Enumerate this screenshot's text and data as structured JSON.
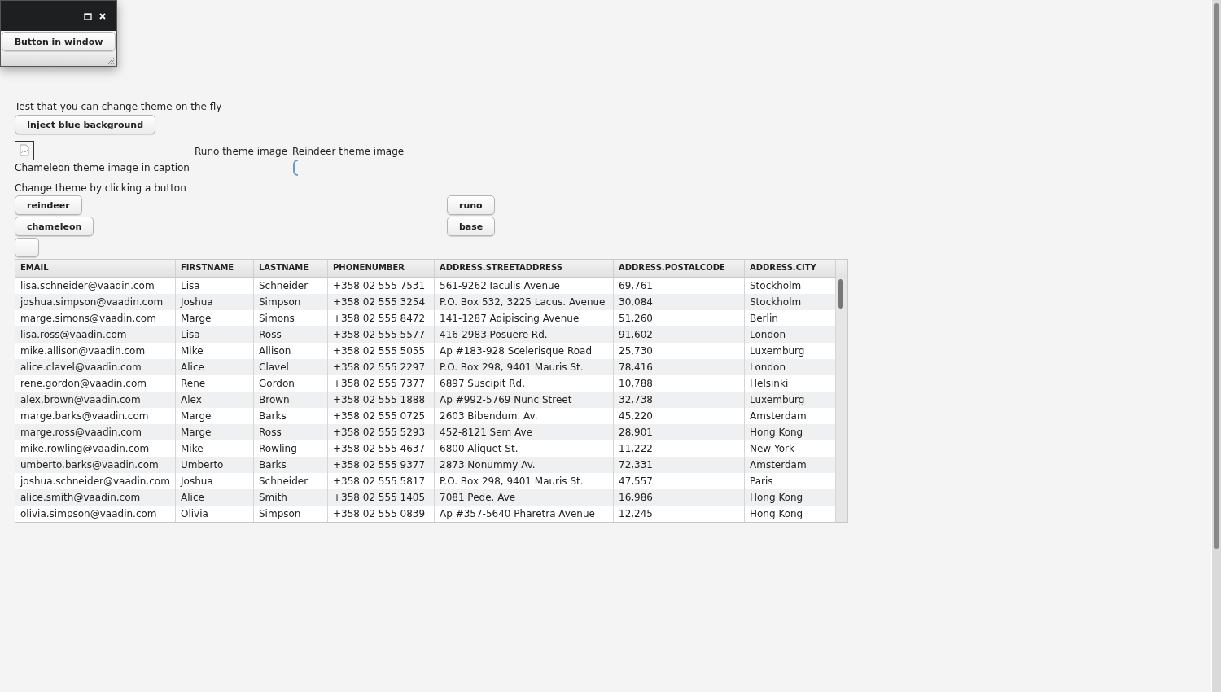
{
  "window": {
    "button": "Button in window"
  },
  "intro": "Test that you can change theme on the fly",
  "inject_button": "Inject blue background",
  "images": {
    "chameleon_caption": "Chameleon theme image in caption",
    "runo_caption": "Runo theme image",
    "reindeer_caption": "Reindeer theme image"
  },
  "theme_label": "Change theme by clicking a button",
  "theme_buttons": [
    "reindeer",
    "runo",
    "chameleon",
    "base"
  ],
  "table": {
    "columns": [
      "EMAIL",
      "FIRSTNAME",
      "LASTNAME",
      "PHONENUMBER",
      "ADDRESS.STREETADDRESS",
      "ADDRESS.POSTALCODE",
      "ADDRESS.CITY"
    ],
    "rows": [
      [
        "lisa.schneider@vaadin.com",
        "Lisa",
        "Schneider",
        "+358 02 555 7531",
        "561-9262 Iaculis Avenue",
        "69,761",
        "Stockholm"
      ],
      [
        "joshua.simpson@vaadin.com",
        "Joshua",
        "Simpson",
        "+358 02 555 3254",
        "P.O. Box 532, 3225 Lacus. Avenue",
        "30,084",
        "Stockholm"
      ],
      [
        "marge.simons@vaadin.com",
        "Marge",
        "Simons",
        "+358 02 555 8472",
        "141-1287 Adipiscing Avenue",
        "51,260",
        "Berlin"
      ],
      [
        "lisa.ross@vaadin.com",
        "Lisa",
        "Ross",
        "+358 02 555 5577",
        "416-2983 Posuere Rd.",
        "91,602",
        "London"
      ],
      [
        "mike.allison@vaadin.com",
        "Mike",
        "Allison",
        "+358 02 555 5055",
        "Ap #183-928 Scelerisque Road",
        "25,730",
        "Luxemburg"
      ],
      [
        "alice.clavel@vaadin.com",
        "Alice",
        "Clavel",
        "+358 02 555 2297",
        "P.O. Box 298, 9401 Mauris St.",
        "78,416",
        "London"
      ],
      [
        "rene.gordon@vaadin.com",
        "Rene",
        "Gordon",
        "+358 02 555 7377",
        "6897 Suscipit Rd.",
        "10,788",
        "Helsinki"
      ],
      [
        "alex.brown@vaadin.com",
        "Alex",
        "Brown",
        "+358 02 555 1888",
        "Ap #992-5769 Nunc Street",
        "32,738",
        "Luxemburg"
      ],
      [
        "marge.barks@vaadin.com",
        "Marge",
        "Barks",
        "+358 02 555 0725",
        "2603 Bibendum. Av.",
        "45,220",
        "Amsterdam"
      ],
      [
        "marge.ross@vaadin.com",
        "Marge",
        "Ross",
        "+358 02 555 5293",
        "452-8121 Sem Ave",
        "28,901",
        "Hong Kong"
      ],
      [
        "mike.rowling@vaadin.com",
        "Mike",
        "Rowling",
        "+358 02 555 4637",
        "6800 Aliquet St.",
        "11,222",
        "New York"
      ],
      [
        "umberto.barks@vaadin.com",
        "Umberto",
        "Barks",
        "+358 02 555 9377",
        "2873 Nonummy Av.",
        "72,331",
        "Amsterdam"
      ],
      [
        "joshua.schneider@vaadin.com",
        "Joshua",
        "Schneider",
        "+358 02 555 5817",
        "P.O. Box 298, 9401 Mauris St.",
        "47,557",
        "Paris"
      ],
      [
        "alice.smith@vaadin.com",
        "Alice",
        "Smith",
        "+358 02 555 1405",
        "7081 Pede. Ave",
        "16,986",
        "Hong Kong"
      ],
      [
        "olivia.simpson@vaadin.com",
        "Olivia",
        "Simpson",
        "+358 02 555 0839",
        "Ap #357-5640 Pharetra Avenue",
        "12,245",
        "Hong Kong"
      ]
    ]
  }
}
